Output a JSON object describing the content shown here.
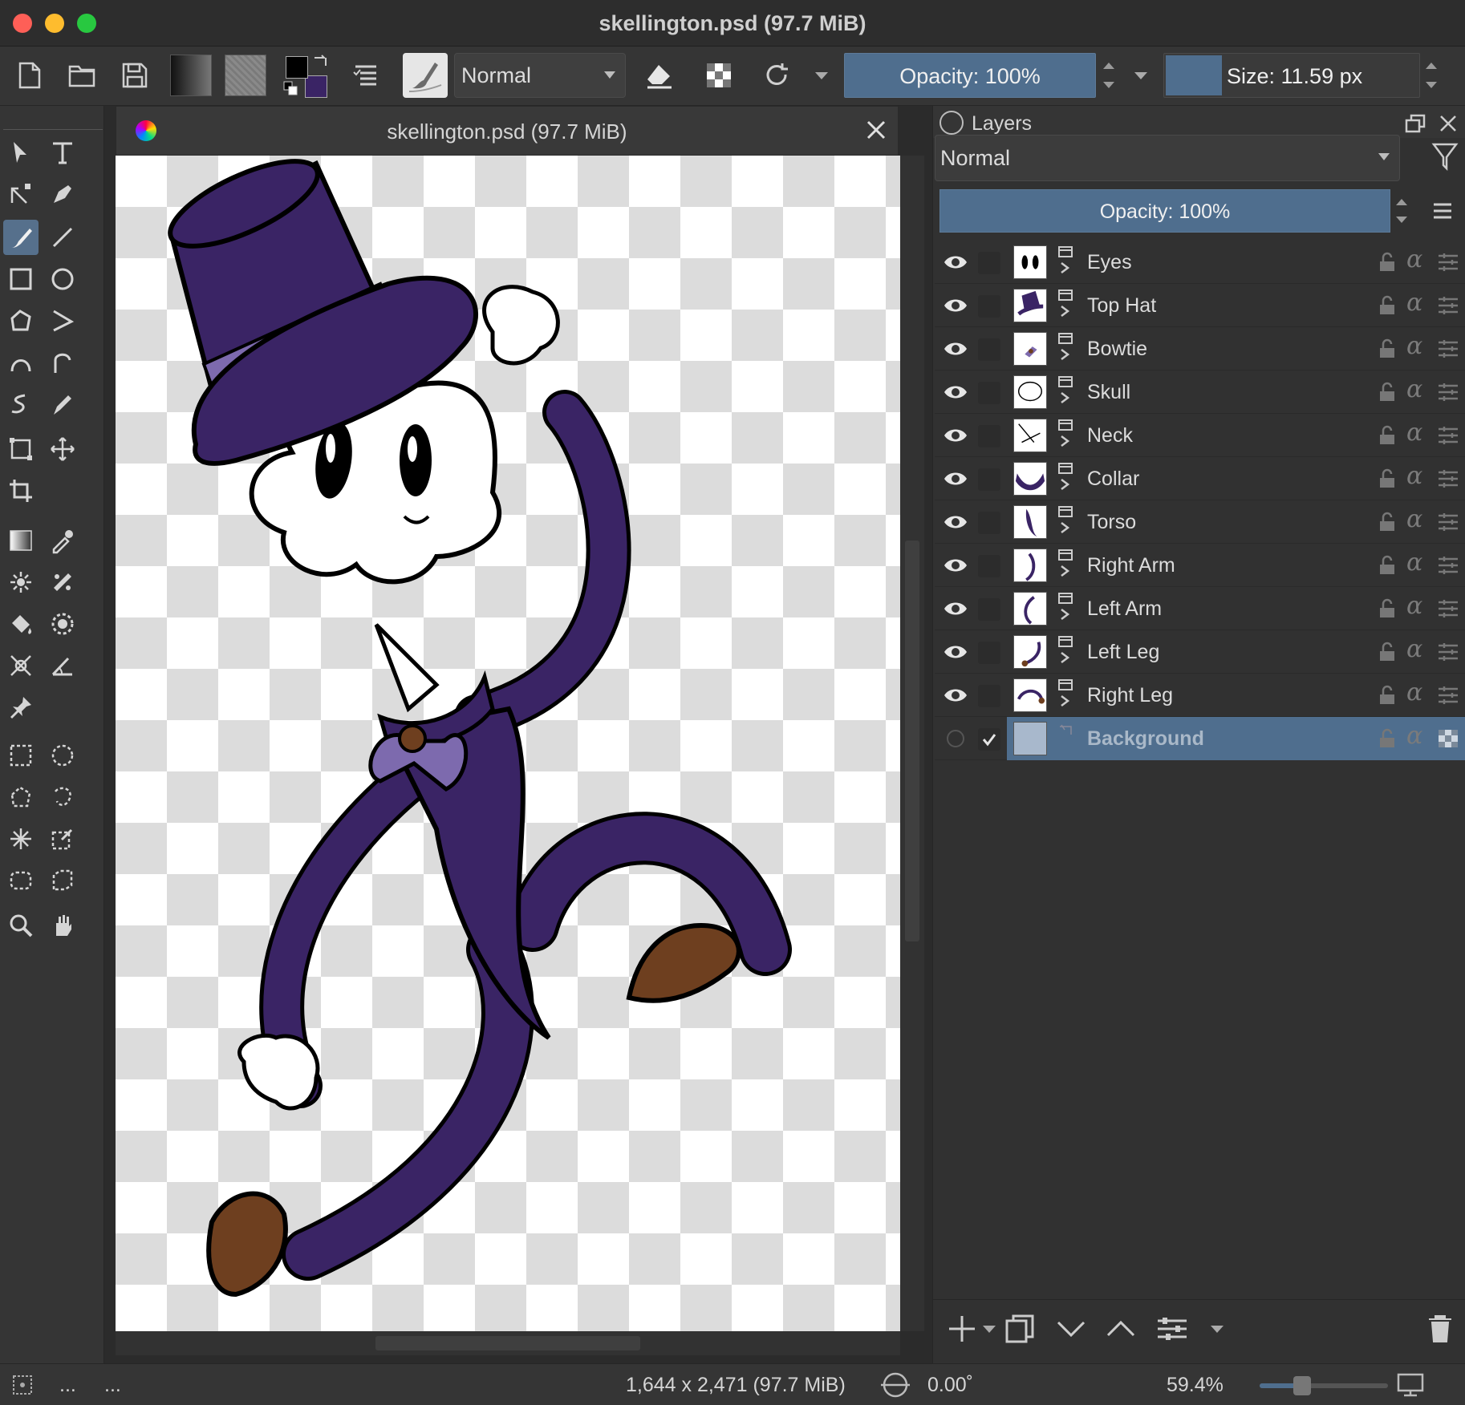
{
  "window": {
    "title": "skellington.psd (97.7 MiB)"
  },
  "toolbar": {
    "blend_mode": "Normal",
    "opacity_label": "Opacity: 100%",
    "size_label": "Size: 11.59 px",
    "fg_color": "#000000",
    "bg_color": "#3a2465"
  },
  "document": {
    "tab_title": "skellington.psd (97.7 MiB)"
  },
  "layers_docker": {
    "title": "Layers",
    "blend_mode": "Normal",
    "opacity_label": "Opacity:  100%",
    "layers": [
      {
        "name": "Eyes",
        "visible": true,
        "selected": false
      },
      {
        "name": "Top Hat",
        "visible": true,
        "selected": false
      },
      {
        "name": "Bowtie",
        "visible": true,
        "selected": false
      },
      {
        "name": "Skull",
        "visible": true,
        "selected": false
      },
      {
        "name": "Neck",
        "visible": true,
        "selected": false
      },
      {
        "name": "Collar",
        "visible": true,
        "selected": false
      },
      {
        "name": "Torso",
        "visible": true,
        "selected": false
      },
      {
        "name": "Right Arm",
        "visible": true,
        "selected": false
      },
      {
        "name": "Left Arm",
        "visible": true,
        "selected": false
      },
      {
        "name": "Left Leg",
        "visible": true,
        "selected": false
      },
      {
        "name": "Right Leg",
        "visible": true,
        "selected": false
      },
      {
        "name": "Background",
        "visible": false,
        "selected": true
      }
    ]
  },
  "statusbar": {
    "left_dots_1": "...",
    "left_dots_2": "...",
    "dimensions": "1,644 x 2,471 (97.7 MiB)",
    "rotation": "0.00˚",
    "zoom": "59.4%"
  },
  "colors": {
    "accent": "#4f6e8e",
    "suit_purple": "#3a2465",
    "hat_band": "#7d6aae",
    "shoe_brown": "#6e3f1f"
  }
}
